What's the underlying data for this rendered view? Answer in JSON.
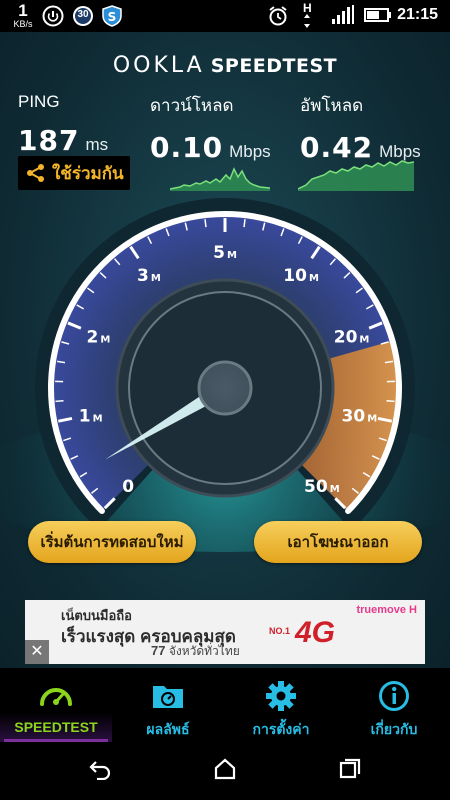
{
  "status_bar": {
    "net_speed": "1",
    "net_unit": "KB/s",
    "notification_count": "30",
    "network_type": "H",
    "time": "21:15",
    "icons": [
      "power-icon",
      "badge-30-icon",
      "shield-s-icon",
      "alarm-icon",
      "data-arrows-icon",
      "signal-icon",
      "battery-icon"
    ]
  },
  "header": {
    "brand": "OOKLA",
    "product": "SPEEDTEST"
  },
  "results": {
    "ping": {
      "label": "PING",
      "value": "187",
      "unit": "ms"
    },
    "download": {
      "label": "ดาวน์โหลด",
      "value": "0.10",
      "unit": "Mbps"
    },
    "upload": {
      "label": "อัพโหลด",
      "value": "0.42",
      "unit": "Mbps"
    }
  },
  "share_button": {
    "label": "ใช้ร่วมกัน",
    "icon": "share-icon"
  },
  "gauge": {
    "scale": [
      {
        "n": "0",
        "u": ""
      },
      {
        "n": "1",
        "u": "M"
      },
      {
        "n": "2",
        "u": "M"
      },
      {
        "n": "3",
        "u": "M"
      },
      {
        "n": "5",
        "u": "M"
      },
      {
        "n": "10",
        "u": "M"
      },
      {
        "n": "20",
        "u": "M"
      },
      {
        "n": "30",
        "u": "M"
      },
      {
        "n": "50",
        "u": "M"
      }
    ],
    "needle_value_mbps": 0.42,
    "accent_upper": "#e08a2a",
    "accent_lower": "#7a6ad8"
  },
  "buttons": {
    "retest": "เริ่มต้นการทดสอบใหม่",
    "remove_ads": "เอาโฆษณาออก"
  },
  "ad": {
    "line1": "เน็ตบนมือถือ",
    "line2": "เร็วแรงสุด ครอบคลุมสุด",
    "line3_num": "77",
    "line3_text": "จังหวัดทั่วไทย",
    "brand": "truemove H",
    "badge": "4G",
    "no1": "NO.1",
    "close": "✕"
  },
  "nav": [
    {
      "label": "SPEEDTEST",
      "icon": "speedometer-icon",
      "active": true
    },
    {
      "label": "ผลลัพธ์",
      "icon": "results-folder-icon",
      "active": false
    },
    {
      "label": "การตั้งค่า",
      "icon": "gear-icon",
      "active": false
    },
    {
      "label": "เกี่ยวกับ",
      "icon": "info-icon",
      "active": false
    }
  ],
  "colors": {
    "accent_yellow": "#f3b429",
    "tab_blue": "#27bde4",
    "tab_active": "#8bd61d"
  }
}
